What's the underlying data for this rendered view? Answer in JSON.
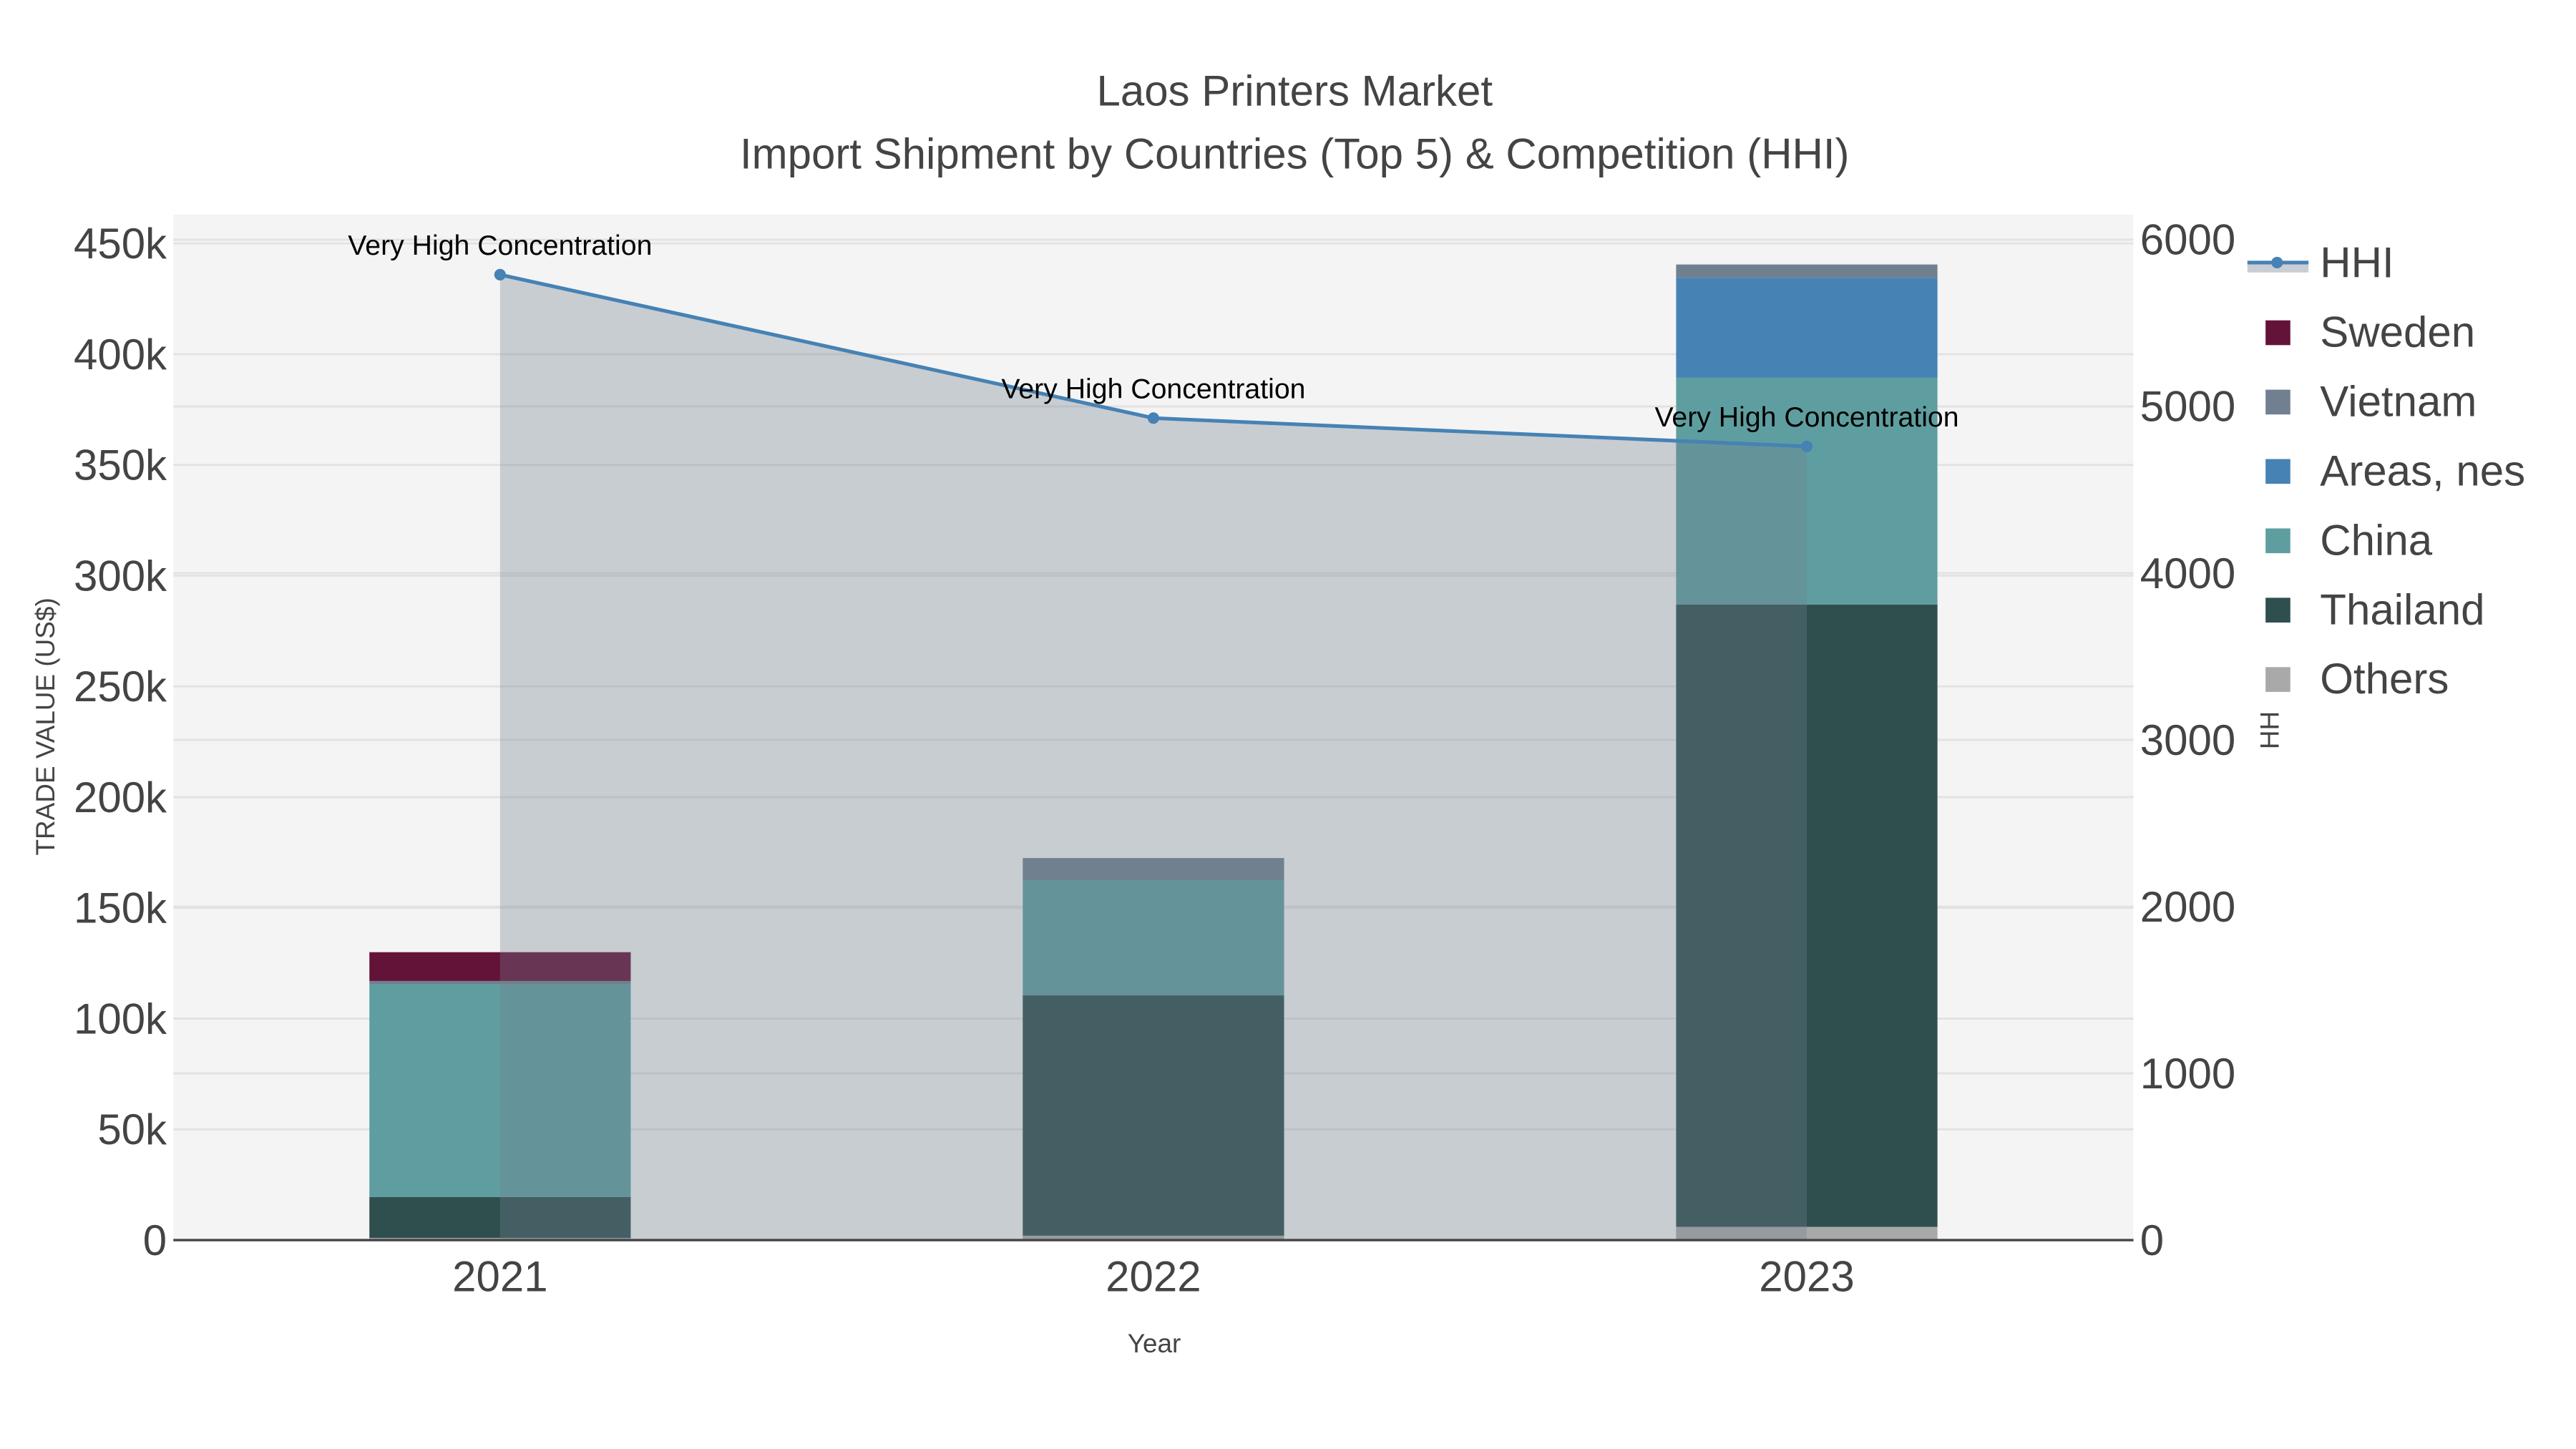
{
  "chart_data": {
    "type": "bar",
    "title": "Laos Printers Market",
    "subtitle": "Import Shipment by Countries (Top 5) & Competition (HHI)",
    "xlabel": "Year",
    "ylabel": "TRADE VALUE (US$)",
    "y2label": "HHI",
    "categories": [
      "2021",
      "2022",
      "2023"
    ],
    "stacked": true,
    "ylim": [
      0,
      463000
    ],
    "y2lim": [
      0,
      6150
    ],
    "yticks": [
      {
        "v": 0,
        "label": "0"
      },
      {
        "v": 50000,
        "label": "50k"
      },
      {
        "v": 100000,
        "label": "100k"
      },
      {
        "v": 150000,
        "label": "150k"
      },
      {
        "v": 200000,
        "label": "200k"
      },
      {
        "v": 250000,
        "label": "250k"
      },
      {
        "v": 300000,
        "label": "300k"
      },
      {
        "v": 350000,
        "label": "350k"
      },
      {
        "v": 400000,
        "label": "400k"
      },
      {
        "v": 450000,
        "label": "450k"
      }
    ],
    "y2ticks": [
      {
        "v": 0,
        "label": "0"
      },
      {
        "v": 1000,
        "label": "1000"
      },
      {
        "v": 2000,
        "label": "2000"
      },
      {
        "v": 3000,
        "label": "3000"
      },
      {
        "v": 4000,
        "label": "4000"
      },
      {
        "v": 5000,
        "label": "5000"
      },
      {
        "v": 6000,
        "label": "6000"
      }
    ],
    "grid": true,
    "legend_placement": "right",
    "series": [
      {
        "name": "Others",
        "color": "#A9A9A9",
        "values": [
          1000,
          2000,
          6000
        ]
      },
      {
        "name": "Thailand",
        "color": "#2F4F4F",
        "values": [
          18500,
          108500,
          281000
        ]
      },
      {
        "name": "China",
        "color": "#5F9EA0",
        "values": [
          96000,
          52000,
          102500
        ]
      },
      {
        "name": "Areas, nes",
        "color": "#4682B4",
        "values": [
          0,
          0,
          45000
        ]
      },
      {
        "name": "Vietnam",
        "color": "#708090",
        "values": [
          1500,
          10000,
          6000
        ]
      },
      {
        "name": "Sweden",
        "color": "#641338",
        "values": [
          13000,
          0,
          0
        ]
      }
    ],
    "line": {
      "name": "HHI",
      "axis": "y2",
      "color": "#4682B4",
      "fill": "rgba(112,128,144,0.33)",
      "values": [
        5790,
        4930,
        4760
      ]
    },
    "annotations": [
      "Very High Concentration",
      "Very High Concentration",
      "Very High Concentration"
    ],
    "legend_order": [
      "HHI",
      "Sweden",
      "Vietnam",
      "Areas, nes",
      "China",
      "Thailand",
      "Others"
    ]
  }
}
